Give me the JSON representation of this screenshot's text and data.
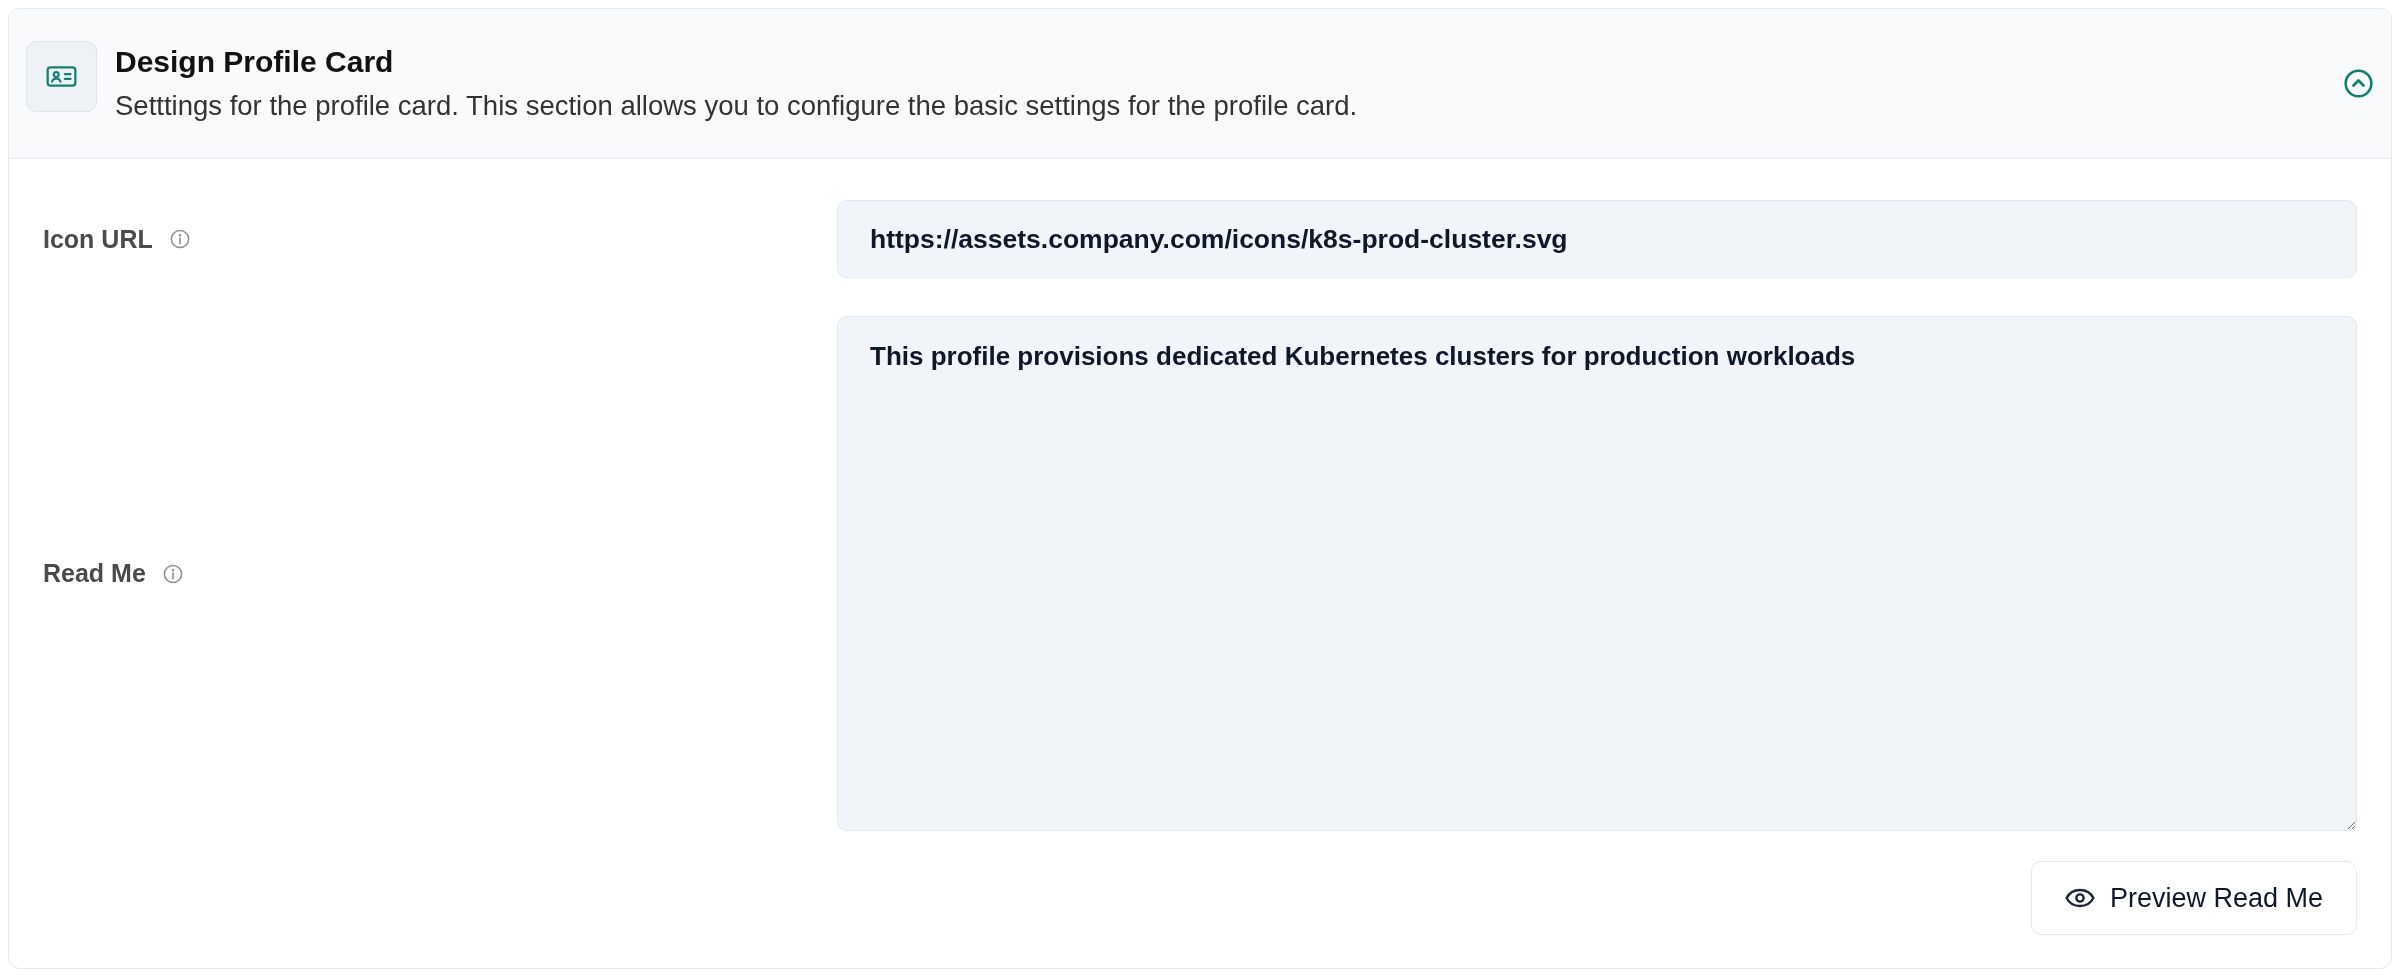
{
  "section": {
    "title": "Design Profile Card",
    "description": "Setttings for the profile card. This section allows you to configure the basic settings for the profile card.",
    "expanded": true
  },
  "fields": [
    {
      "kind": "text",
      "label": "Icon URL",
      "value": "https://assets.company.com/icons/k8s-prod-cluster.svg"
    },
    {
      "kind": "textarea",
      "label": "Read Me",
      "value": "This profile provisions dedicated Kubernetes clusters for production workloads"
    }
  ],
  "actions": [
    {
      "label": "Preview Read Me"
    }
  ]
}
